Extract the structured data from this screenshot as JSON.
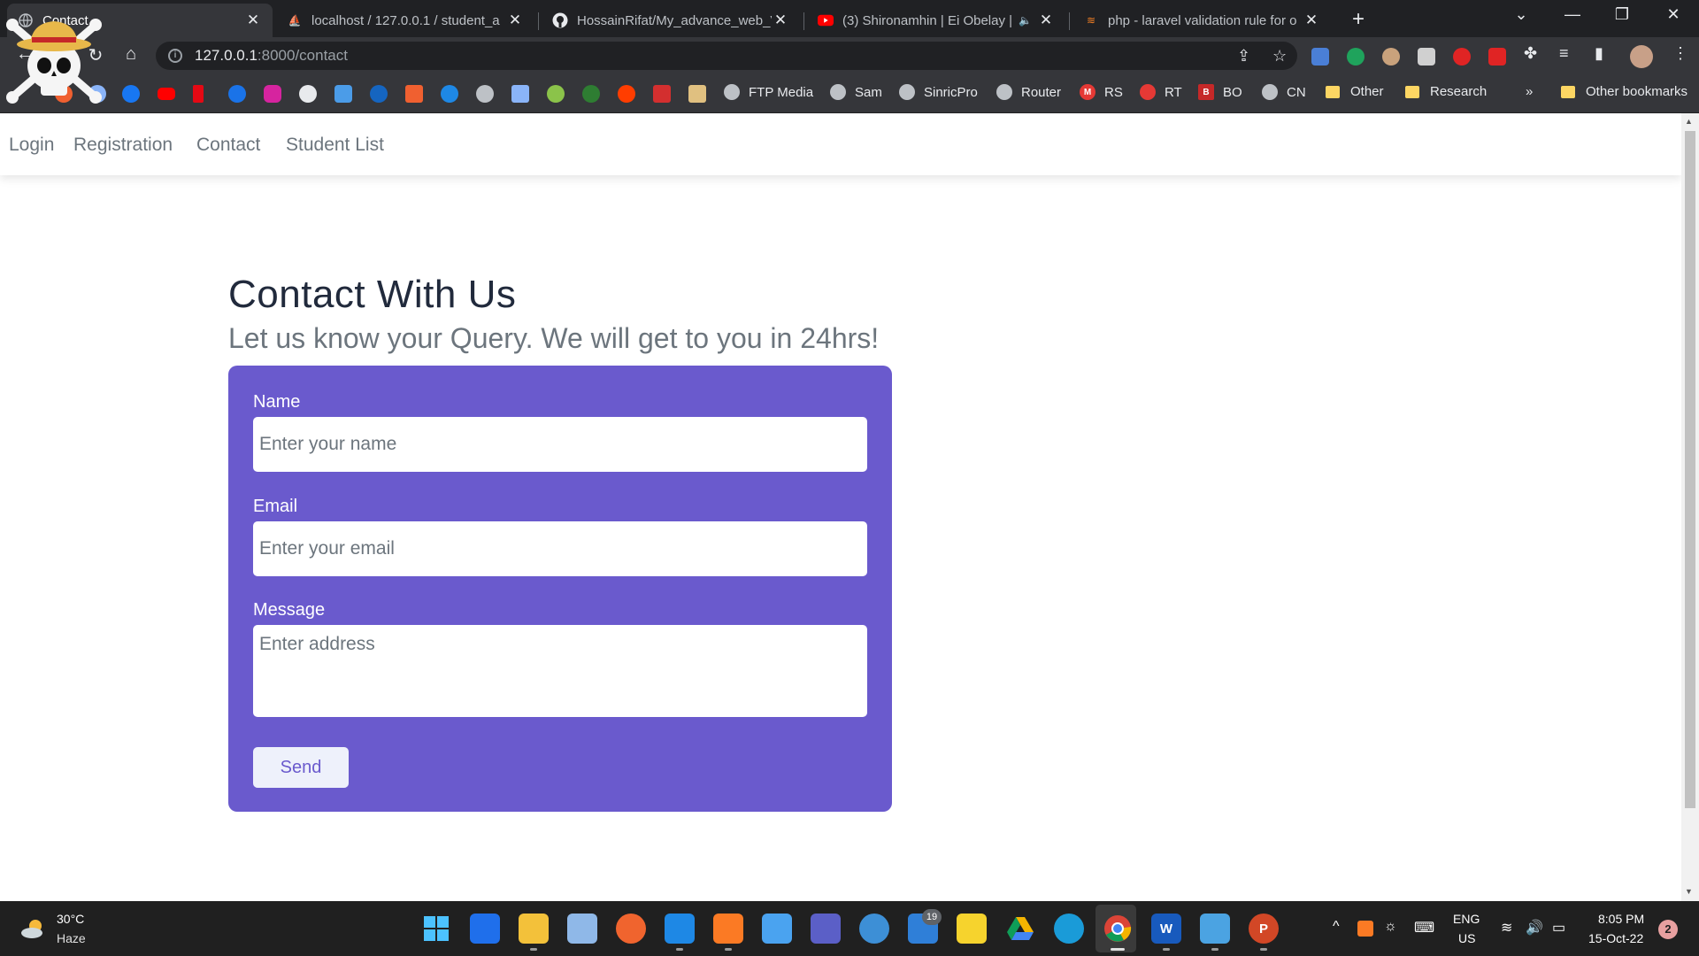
{
  "browser": {
    "tabs": [
      {
        "title": "Contact",
        "active": true
      },
      {
        "title": "localhost / 127.0.0.1 / student_a"
      },
      {
        "title": "HossainRifat/My_advance_web_V"
      },
      {
        "title": "(3) Shironamhin | Ei Obelay |"
      },
      {
        "title": "php - laravel validation rule for o"
      }
    ],
    "address": {
      "host": "127.0.0.1",
      "path": ":8000/contact"
    },
    "bookmarks": [
      {
        "label": "FTP Media"
      },
      {
        "label": "Sam"
      },
      {
        "label": "SinricPro"
      },
      {
        "label": "Router"
      },
      {
        "label": "RS"
      },
      {
        "label": "RT"
      },
      {
        "label": "BO"
      },
      {
        "label": "CN"
      },
      {
        "label": "Other"
      },
      {
        "label": "Research"
      }
    ],
    "overflow_label": "»",
    "other_bookmarks": "Other bookmarks"
  },
  "site_nav": {
    "items": [
      "Login",
      "Registration",
      "Contact",
      "Student List"
    ]
  },
  "page": {
    "title": "Contact With Us",
    "subtitle": "Let us know your Query. We will get to you in 24hrs!",
    "form": {
      "name_label": "Name",
      "name_placeholder": "Enter your name",
      "email_label": "Email",
      "email_placeholder": "Enter your email",
      "message_label": "Message",
      "message_placeholder": "Enter address",
      "send_label": "Send"
    },
    "accent_color": "#6a5acd"
  },
  "taskbar": {
    "weather_temp": "30°C",
    "weather_desc": "Haze",
    "teams_badge": "19",
    "lang_line1": "ENG",
    "lang_line2": "US",
    "time": "8:05 PM",
    "date": "15-Oct-22",
    "notifications": "2"
  }
}
